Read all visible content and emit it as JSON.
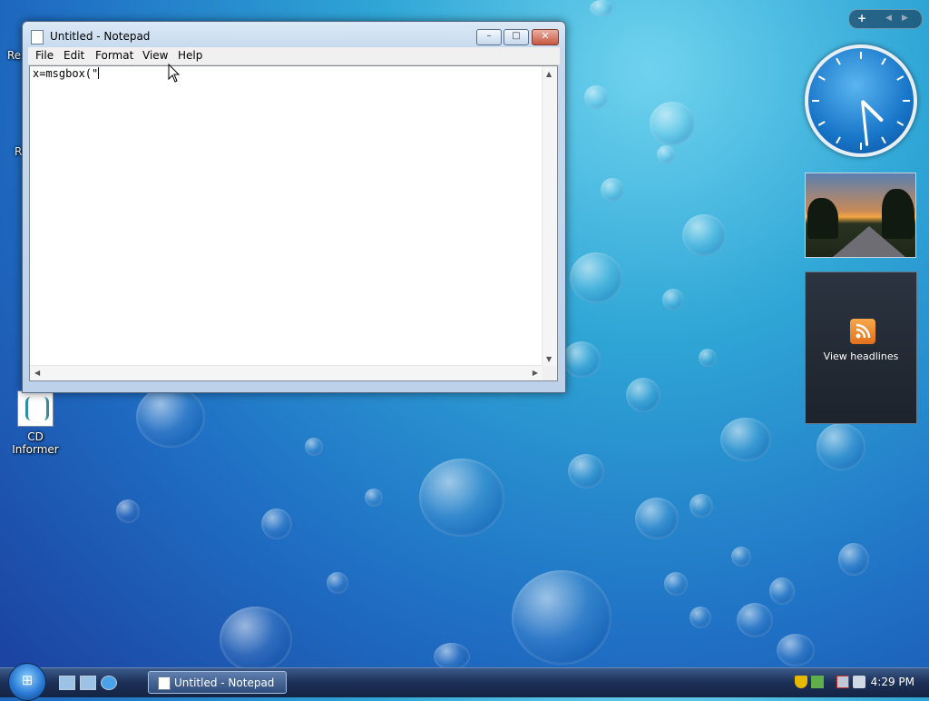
{
  "desktop": {
    "icons": [
      {
        "label": "Re",
        "name": "recycle-bin-partial"
      },
      {
        "label": "R",
        "name": "partial-icon"
      },
      {
        "label": "CD Informer",
        "name": "cd-informer"
      }
    ]
  },
  "notepad": {
    "title": "Untitled - Notepad",
    "menu": [
      "File",
      "Edit",
      "Format",
      "View",
      "Help"
    ],
    "content": "x=msgbox(\"",
    "buttons": {
      "minimize": "–",
      "maximize": "□",
      "close": "✕"
    }
  },
  "sidebar": {
    "controls": {
      "add": "+",
      "prev": "◀",
      "next": "▶"
    },
    "clock": {
      "hour": 4,
      "minute": 29
    },
    "feeds": {
      "label": "View headlines",
      "icon": "rss-icon"
    }
  },
  "taskbar": {
    "task_label": "Untitled - Notepad",
    "time": "4:29 PM",
    "start_icon": "windows-logo-icon"
  },
  "colors": {
    "taskbar": "#1c2f55",
    "close_button": "#c8563f",
    "desktop_accent": "#2fa6d6"
  }
}
